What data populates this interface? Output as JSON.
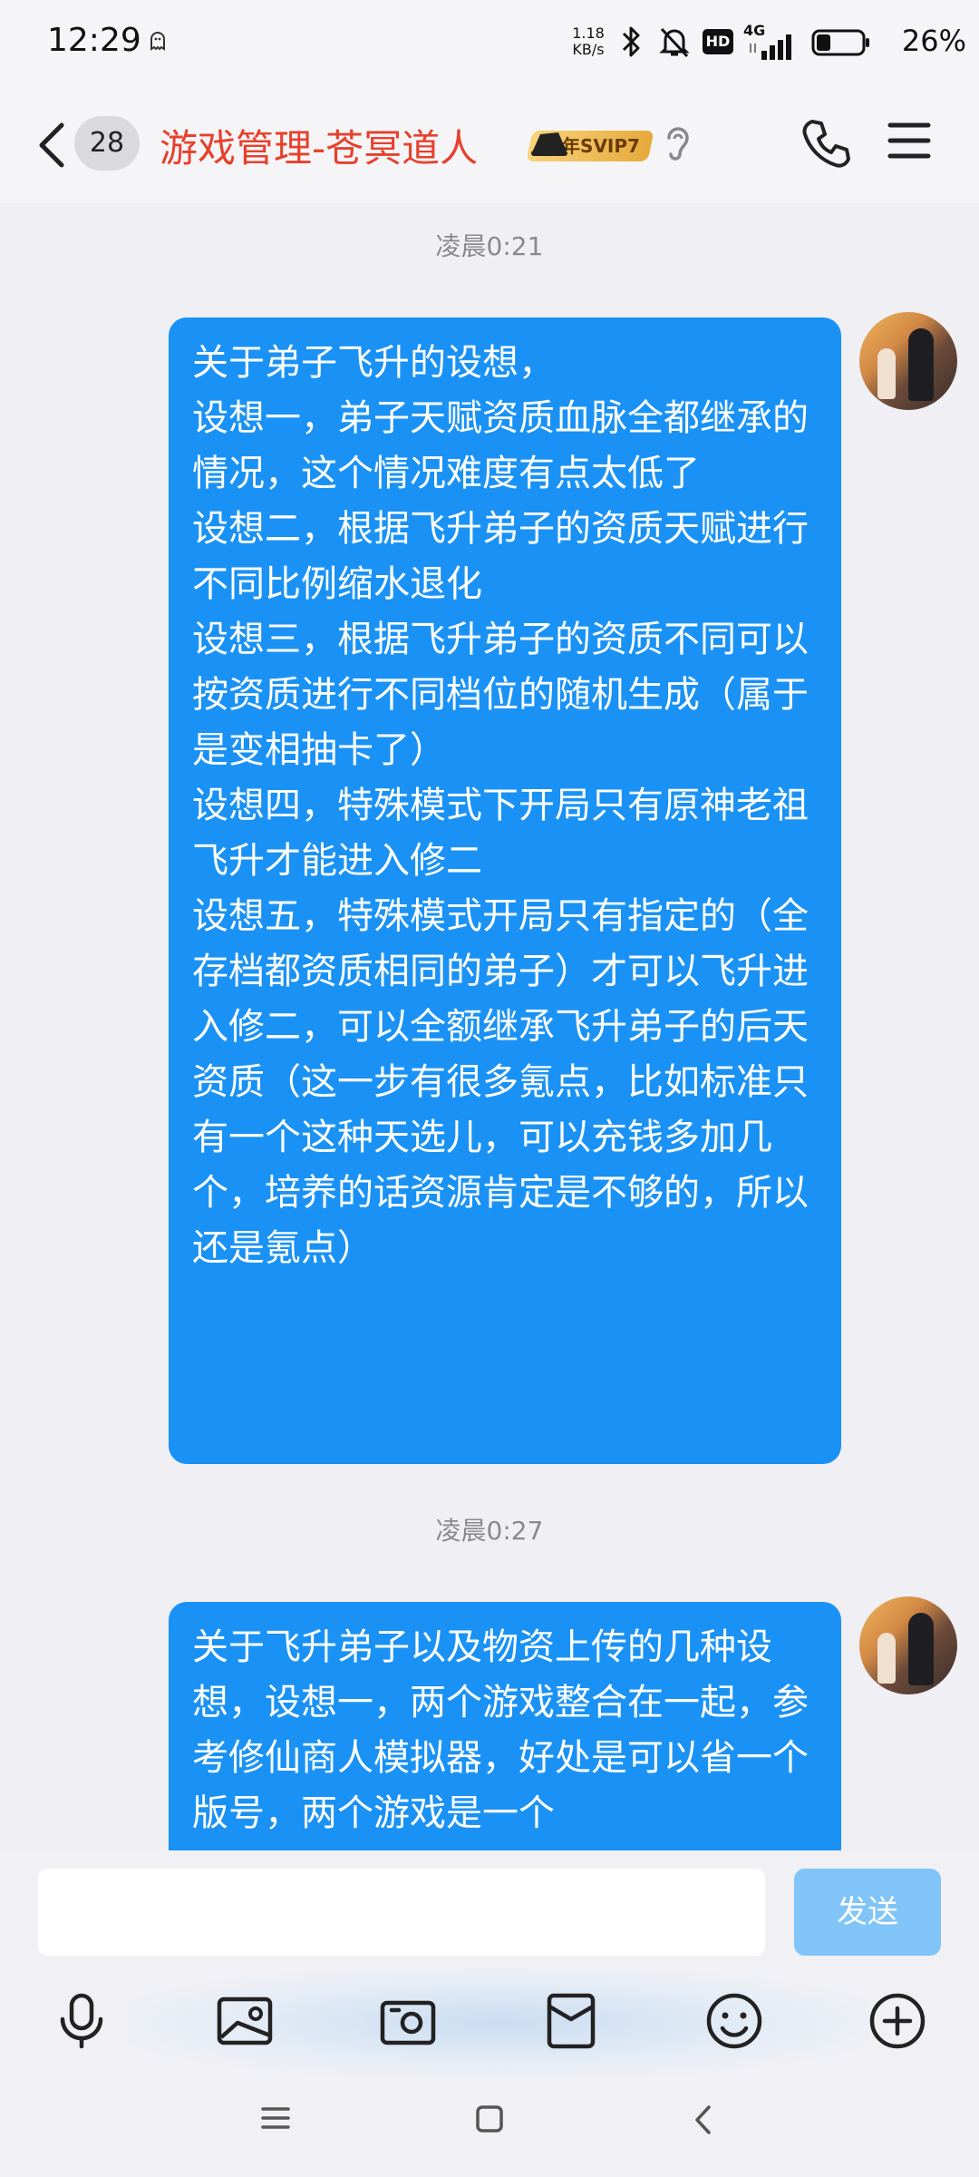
{
  "status_bar": {
    "time": "12:29",
    "net_speed_value": "1.18",
    "net_speed_unit": "KB/s",
    "hd_label": "HD",
    "network_label": "4G",
    "battery": "26%",
    "icons": [
      "ghost-icon",
      "bluetooth-icon",
      "mute-icon",
      "hd-icon",
      "signal-icon",
      "battery-icon"
    ]
  },
  "header": {
    "unread_count": "28",
    "title": "游戏管理-苍冥道人",
    "vip_label": "年SVIP7",
    "colors": {
      "title": "#e8402c",
      "vip_gold": "#e6a93b"
    }
  },
  "messages": [
    {
      "time": "凌晨0:21",
      "text": "关于弟子飞升的设想，\n设想一，弟子天赋资质血脉全都继承的情况，这个情况难度有点太低了\n设想二，根据飞升弟子的资质天赋进行不同比例缩水退化\n设想三，根据飞升弟子的资质不同可以按资质进行不同档位的随机生成（属于是变相抽卡了）\n设想四，特殊模式下开局只有原神老祖飞升才能进入修二\n设想五，特殊模式开局只有指定的（全存档都资质相同的弟子）才可以飞升进入修二，可以全额继承飞升弟子的后天资质（这一步有很多氪点，比如标准只有一个这种天选儿，可以充钱多加几个，培养的话资源肯定是不够的，所以还是氪点）"
    },
    {
      "time": "凌晨0:27",
      "text": "关于飞升弟子以及物资上传的几种设想，设想一，两个游戏整合在一起，参考修仙商人模拟器，好处是可以省一个版号，两个游戏是一个"
    }
  ],
  "input": {
    "placeholder": "",
    "value": "",
    "send_label": "发送"
  },
  "toolbar": [
    "microphone-icon",
    "image-icon",
    "camera-icon",
    "red-packet-icon",
    "emoji-icon",
    "plus-icon"
  ],
  "nav": [
    "menu-icon",
    "home-icon",
    "back-icon"
  ],
  "colors": {
    "bubble": "#1a92f5",
    "send_button": "#80c4f8",
    "background": "#efeff4"
  }
}
